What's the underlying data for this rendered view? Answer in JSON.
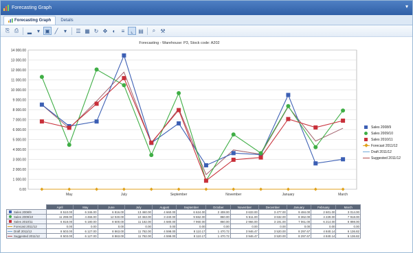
{
  "window": {
    "title": "Forecasting Graph"
  },
  "tabs": [
    {
      "label": "Forecasting Graph"
    },
    {
      "label": "Details"
    }
  ],
  "toolbar": {
    "icons": [
      "copy-icon",
      "print-icon",
      "chart-type-icon",
      "dropdown-icon",
      "select-icon",
      "line-style-icon",
      "dropdown-icon",
      "properties-icon",
      "data-table-icon",
      "rotate-icon",
      "move-icon",
      "palette-icon",
      "legend-icon",
      "axis-icon",
      "grid-icon",
      "zoom-icon",
      "tools-icon"
    ]
  },
  "chart_data": {
    "type": "line",
    "title": "Forecasting - Warehouse: P3, Stock code: A202",
    "xlabel": "",
    "ylabel": "",
    "ylim": [
      0,
      14000
    ],
    "yticks": [
      "14 000.00",
      "13 000.00",
      "12 000.00",
      "11 000.00",
      "10 000.00",
      "9 000.00",
      "8 000.00",
      "7 000.00",
      "6 000.00",
      "5 000.00",
      "4 000.00",
      "3 000.00",
      "2 000.00",
      "1 000.00",
      "0.00"
    ],
    "categories": [
      "April",
      "May",
      "June",
      "July",
      "August",
      "September",
      "October",
      "November",
      "December",
      "January",
      "February",
      "March"
    ],
    "xtick_labels": [
      "May",
      "July",
      "September",
      "November",
      "January",
      "March"
    ],
    "grid": true,
    "legend_position": "right",
    "series": [
      {
        "name": "Sales 2008/9",
        "color": "#3c5fb4",
        "marker": "square",
        "values": [
          8510,
          6346,
          6816,
          13460,
          4660,
          6624,
          2408,
          3633,
          3477,
          9484,
          2601,
          3014
        ]
      },
      {
        "name": "Sales 2009/10",
        "color": "#3fae45",
        "marker": "circle",
        "values": [
          11298,
          4466,
          12040,
          10463,
          3440,
          9662,
          860,
          5511,
          3632,
          8362,
          4229,
          7918
        ]
      },
      {
        "name": "Sales 2010/11",
        "color": "#c8303a",
        "marker": "square",
        "values": [
          6818,
          6180,
          8600,
          11182,
          4680,
          7960,
          860,
          2966,
          3191,
          7061,
          6214,
          6898
        ]
      },
      {
        "name": "Forecast 2011/12",
        "color": "#e0a21c",
        "marker": "diamond",
        "values": [
          0,
          0,
          0,
          0,
          0,
          0,
          0,
          0,
          0,
          0,
          0,
          0
        ]
      },
      {
        "name": "Draft 2011/12",
        "color": "#6fa9d8",
        "marker": "line",
        "values": [
          8503,
          6127,
          8863,
          11782,
          4598,
          8110,
          1470,
          3946,
          3520,
          8297,
          4840,
          6136
        ]
      },
      {
        "name": "Suggested 2011/12",
        "color": "#b04a4a",
        "marker": "line",
        "values": [
          8503,
          6127,
          8863,
          11782,
          4598,
          8110,
          1470,
          3946,
          3520,
          8297,
          4840,
          6136
        ]
      }
    ]
  },
  "table": {
    "rows": [
      {
        "label": "Sales 2008/9",
        "cells": [
          "8 510.00",
          "6 346.00",
          "6 816.00",
          "13 460.00",
          "4 660.00",
          "6 624.00",
          "2 408.00",
          "3 633.00",
          "3 477.00",
          "9 484.00",
          "2 601.00",
          "3 014.00"
        ]
      },
      {
        "label": "Sales 2009/10",
        "cells": [
          "11 298.00",
          "4 466.00",
          "12 040.00",
          "10 463.00",
          "3 440.00",
          "9 662.00",
          "860.00",
          "5 511.00",
          "3 632.00",
          "8 362.00",
          "4 229.00",
          "7 918.00"
        ]
      },
      {
        "label": "Sales 2010/11",
        "cells": [
          "6 818.00",
          "6 180.00",
          "8 600.00",
          "11 182.00",
          "4 680.00",
          "7 960.00",
          "860.00",
          "2 966.00",
          "3 191.00",
          "7 061.00",
          "6 214.00",
          "6 898.00"
        ]
      },
      {
        "label": "Forecast 2011/12",
        "cells": [
          "0.00",
          "0.00",
          "0.00",
          "0.00",
          "0.00",
          "0.00",
          "0.00",
          "0.00",
          "0.00",
          "0.00",
          "0.00",
          "0.00"
        ]
      },
      {
        "label": "Draft 2011/12",
        "cells": [
          "8 503.00",
          "6 127.00",
          "8 863.00",
          "11 782.00",
          "4 598.00",
          "8 110.17",
          "1 470.72",
          "3 946.47",
          "3 520.00",
          "8 297.67",
          "4 840.14",
          "6 136.82"
        ]
      },
      {
        "label": "Suggested 2011/12",
        "cells": [
          "8 503.00",
          "6 127.00",
          "8 863.00",
          "11 782.00",
          "4 598.00",
          "8 110.17",
          "1 470.72",
          "3 946.47",
          "3 520.00",
          "8 297.67",
          "4 840.14",
          "6 136.82"
        ]
      }
    ]
  }
}
